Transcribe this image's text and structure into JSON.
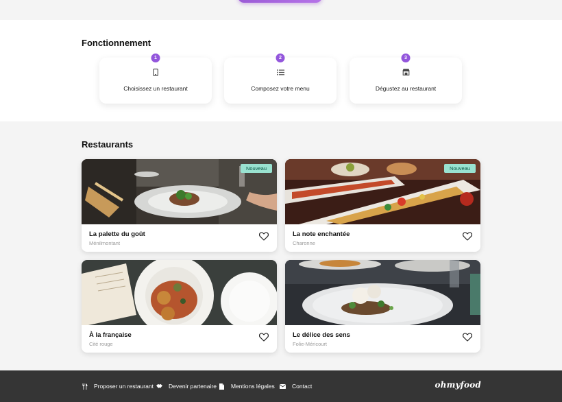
{
  "how": {
    "title": "Fonctionnement",
    "steps": [
      {
        "number": "1",
        "label": "Choisissez un restaurant",
        "icon": "mobile-phone-icon"
      },
      {
        "number": "2",
        "label": "Composez votre menu",
        "icon": "list-icon"
      },
      {
        "number": "3",
        "label": "Dégustez au restaurant",
        "icon": "store-icon"
      }
    ]
  },
  "restaurants": {
    "title": "Restaurants",
    "badge_label": "Nouveau",
    "items": [
      {
        "name": "La palette du goût",
        "location": "Ménilmontant",
        "is_new": true
      },
      {
        "name": "La note enchantée",
        "location": "Charonne",
        "is_new": true
      },
      {
        "name": "À la française",
        "location": "Cité rouge",
        "is_new": false
      },
      {
        "name": "Le délice des sens",
        "location": "Folie-Méricourt",
        "is_new": false
      }
    ]
  },
  "footer": {
    "links": [
      {
        "label": "Proposer un restaurant",
        "icon": "utensils-icon"
      },
      {
        "label": "Devenir partenaire",
        "icon": "handshake-icon"
      },
      {
        "label": "Mentions légales",
        "icon": "file-icon"
      },
      {
        "label": "Contact",
        "icon": "envelope-icon"
      }
    ],
    "brand": "ohmyfood"
  },
  "colors": {
    "accent": "#9356dc",
    "badge_new_bg": "#99e2d0",
    "footer_bg": "#353535",
    "page_bg": "#f4f4f4"
  }
}
